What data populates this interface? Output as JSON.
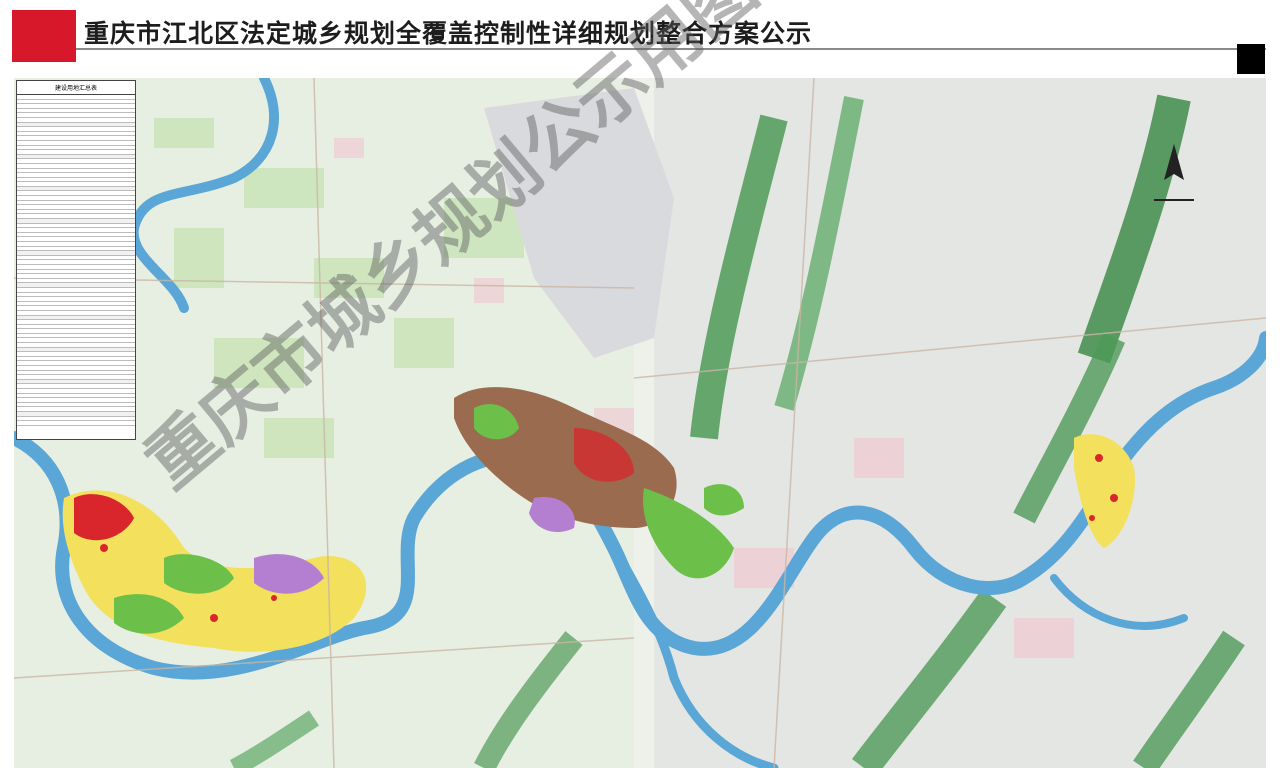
{
  "header": {
    "title": "重庆市江北区法定城乡规划全覆盖控制性详细规划整合方案公示"
  },
  "legend": {
    "title": "建设用地汇总表"
  },
  "watermark": {
    "main": "重庆市城乡规划公示用图"
  },
  "colors": {
    "brand_red": "#d7182a",
    "river": "#5aa6d6",
    "river_fill": "#7fb9dc",
    "forest": "#3f8c4a",
    "residential": "#f3e05c",
    "commercial": "#d8262c",
    "green_space": "#6cc04a",
    "industrial": "#9a6b4f",
    "public": "#b57fd1",
    "base": "#eef1ea"
  },
  "icons": {
    "north_arrow": "north-arrow-icon",
    "legend_mark": "black-square-icon"
  }
}
